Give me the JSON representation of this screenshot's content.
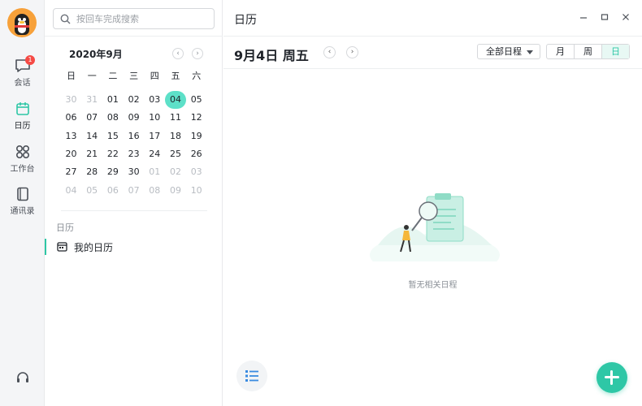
{
  "rail": {
    "items": [
      {
        "label": "会话",
        "badge": "1"
      },
      {
        "label": "日历"
      },
      {
        "label": "工作台"
      },
      {
        "label": "通讯录"
      }
    ]
  },
  "search": {
    "placeholder": "按回车完成搜索"
  },
  "mini_calendar": {
    "title": "2020年9月",
    "prev": "‹",
    "next": "›",
    "weekdays": [
      "日",
      "一",
      "二",
      "三",
      "四",
      "五",
      "六"
    ],
    "days": [
      [
        "30",
        "31",
        "01",
        "02",
        "03",
        "04",
        "05"
      ],
      [
        "06",
        "07",
        "08",
        "09",
        "10",
        "11",
        "12"
      ],
      [
        "13",
        "14",
        "15",
        "16",
        "17",
        "18",
        "19"
      ],
      [
        "20",
        "21",
        "22",
        "23",
        "24",
        "25",
        "26"
      ],
      [
        "27",
        "28",
        "29",
        "30",
        "01",
        "02",
        "03"
      ],
      [
        "04",
        "05",
        "06",
        "07",
        "08",
        "09",
        "10"
      ]
    ],
    "selected": "04"
  },
  "calendars": {
    "section_title": "日历",
    "items": [
      {
        "label": "我的日历"
      }
    ]
  },
  "main": {
    "title": "日历",
    "date_title": "9月4日 周五",
    "prev": "‹",
    "next": "›",
    "filter": "全部日程",
    "view_modes": [
      "月",
      "周",
      "日"
    ],
    "active_view": "日",
    "empty_text": "暂无相关日程"
  },
  "colors": {
    "accent": "#2ec7a6",
    "selected_day": "#5de0c8",
    "badge": "#f54a45"
  }
}
